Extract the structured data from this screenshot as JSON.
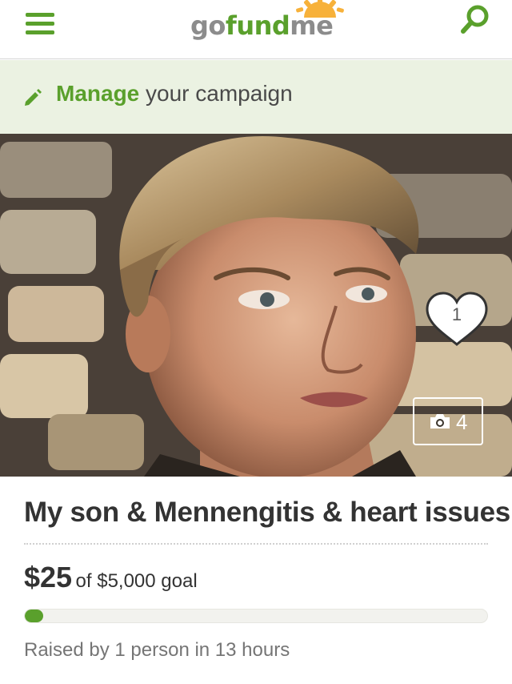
{
  "header": {
    "logo_prefix": "go",
    "logo_fund": "fund",
    "logo_suffix": "me"
  },
  "manage": {
    "strong": "Manage",
    "rest": " your campaign"
  },
  "hero": {
    "heart_count": "1",
    "photo_count": "4"
  },
  "campaign": {
    "title": "My son & Mennengitis & heart issues",
    "amount_raised": "$25",
    "goal_text": "of $5,000 goal",
    "progress_fraction": 0.005,
    "meta": "Raised by 1 person in 13 hours"
  },
  "icons": {
    "menu": "hamburger-menu-icon",
    "search": "search-icon",
    "manage": "pencil-icon",
    "heart": "heart-icon",
    "photos": "camera-icon"
  },
  "colors": {
    "brand_green": "#5aa02c",
    "logo_gray": "#8c8c8c",
    "sun_orange": "#f7b13a",
    "manage_bg": "#ebf2e2",
    "text": "#333333",
    "muted": "#757575"
  }
}
